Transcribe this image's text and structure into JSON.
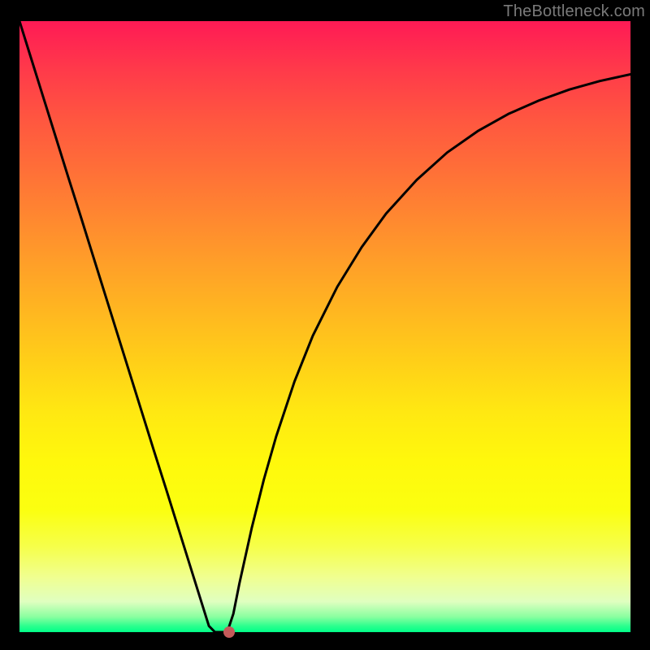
{
  "watermark": "TheBottleneck.com",
  "chart_data": {
    "type": "line",
    "title": "",
    "xlabel": "",
    "ylabel": "",
    "xlim": [
      0,
      100
    ],
    "ylim": [
      0,
      100
    ],
    "grid": false,
    "legend": false,
    "series": [
      {
        "name": "bottleneck-curve",
        "x": [
          0,
          2,
          4,
          6,
          8,
          10,
          12,
          14,
          16,
          18,
          20,
          22,
          24,
          26,
          28,
          30,
          31,
          32,
          33,
          34,
          35,
          36,
          38,
          40,
          42,
          45,
          48,
          52,
          56,
          60,
          65,
          70,
          75,
          80,
          85,
          90,
          95,
          100
        ],
        "y": [
          100,
          93.6,
          87.2,
          80.8,
          74.4,
          68.1,
          61.7,
          55.3,
          48.9,
          42.5,
          36.1,
          29.7,
          23.4,
          17.0,
          10.6,
          4.2,
          1.0,
          0.0,
          0.0,
          0.0,
          3.0,
          8.0,
          17.0,
          25.0,
          32.0,
          41.0,
          48.5,
          56.5,
          63.0,
          68.5,
          74.0,
          78.5,
          82.0,
          84.8,
          87.0,
          88.8,
          90.2,
          91.3
        ]
      }
    ],
    "marker": {
      "x": 34.3,
      "y": 0,
      "color": "#c45a5a"
    },
    "background_gradient": {
      "top": "#ff1a55",
      "mid": "#ffd018",
      "bottom": "#00ff88"
    }
  },
  "plot": {
    "marker_left_pct": 34.3,
    "marker_bottom_pct": 0.6
  }
}
